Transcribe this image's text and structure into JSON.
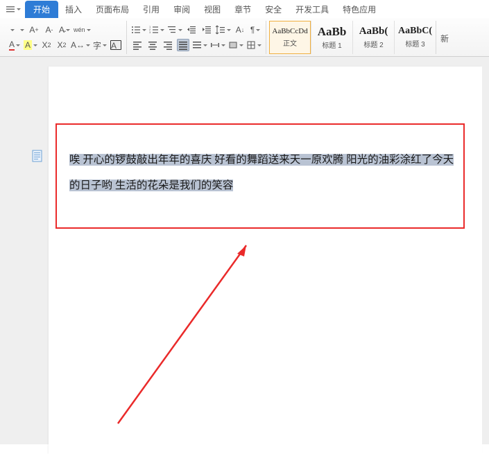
{
  "menu": {
    "items": [
      "开始",
      "插入",
      "页面布局",
      "引用",
      "审阅",
      "视图",
      "章节",
      "安全",
      "开发工具",
      "特色应用"
    ],
    "active": 0
  },
  "ribbon": {
    "font": {
      "grow": "A+",
      "shrink": "A-",
      "case": "Aa",
      "phonetic": "wén",
      "color": "A",
      "highlight": "A",
      "sub": "X₂",
      "sup": "X²",
      "charscale": "A",
      "charborder": "字",
      "clear": "A"
    },
    "para": {
      "bullets": "•",
      "numbers": "1",
      "multilist": "⠿",
      "indent_dec": "←",
      "indent_inc": "→",
      "linespace": "↕",
      "sort": "A↓",
      "showmarks": "¶",
      "align_l": "≡",
      "align_c": "≡",
      "align_r": "≡",
      "align_j": "≡",
      "distrib": "≡",
      "tabstops": "⇥",
      "shading": "▭",
      "borders": "▦"
    }
  },
  "styles": {
    "tiles": [
      {
        "preview": "AaBbCcDd",
        "label": "正文"
      },
      {
        "preview": "AaBb",
        "label": "标题 1"
      },
      {
        "preview": "AaBb(",
        "label": "标题 2"
      },
      {
        "preview": "AaBbC(",
        "label": "标题 3"
      }
    ],
    "more": "新"
  },
  "doc": {
    "text": "唉 开心的锣鼓敲出年年的喜庆 好看的舞蹈送来天一原欢腾 阳光的油彩涂红了今天的日子哟 生活的花朵是我们的笑容"
  }
}
